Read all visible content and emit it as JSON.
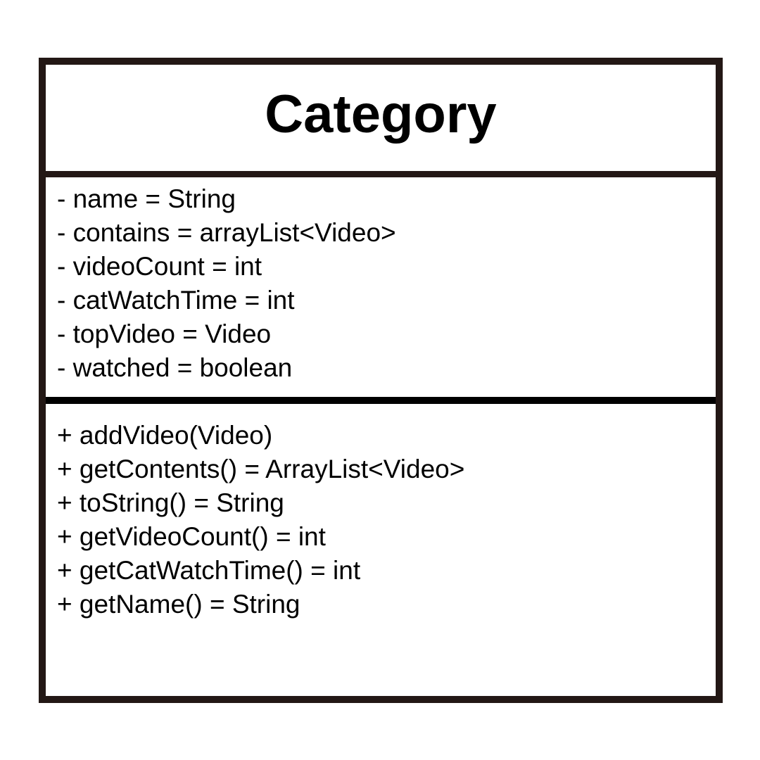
{
  "class_box": {
    "name": "Category",
    "attributes": [
      "- name = String",
      "- contains = arrayList<Video>",
      "- videoCount = int",
      "- catWatchTime = int",
      "- topVideo = Video",
      "- watched = boolean"
    ],
    "operations": [
      "+ addVideo(Video)",
      "+ getContents() = ArrayList<Video>",
      "+ toString() = String",
      "+ getVideoCount() = int",
      "+ getCatWatchTime() = int",
      "+ getName() = String"
    ]
  },
  "colors": {
    "border": "#231815",
    "divider": "#000000",
    "background": "#ffffff",
    "text": "#000000"
  }
}
